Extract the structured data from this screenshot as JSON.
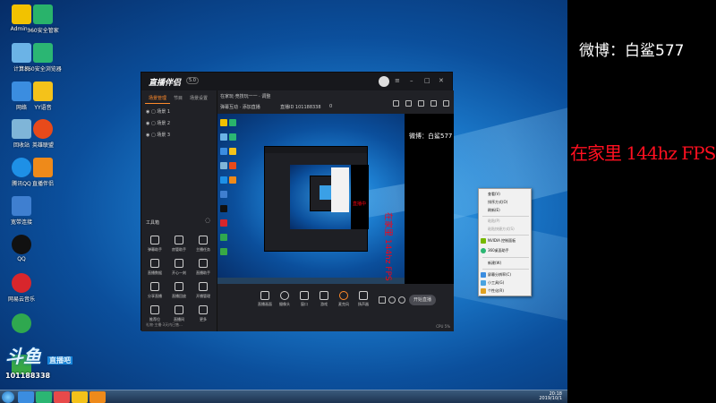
{
  "overlay": {
    "weibo": "微博：白鲨577",
    "highlight": "在家里 144hz  FPS 150"
  },
  "desktop": {
    "icons": [
      {
        "label": "Admin...",
        "color": "#f2c200"
      },
      {
        "label": "360安全管家",
        "color": "#29b36b"
      },
      {
        "label": "计算机",
        "color": "#6bb3e6"
      },
      {
        "label": "360安全浏览器",
        "color": "#2bb673"
      },
      {
        "label": "网络",
        "color": "#3b8de0"
      },
      {
        "label": "YY语音",
        "color": "#f4c21a"
      },
      {
        "label": "回收站",
        "color": "#7fb5d8"
      },
      {
        "label": "英雄联盟",
        "color": "#e84a1a"
      },
      {
        "label": "腾讯QQ",
        "color": "#1e90e6"
      },
      {
        "label": "直播伴侣",
        "color": "#ee8a1a"
      },
      {
        "label": "宽带连接",
        "color": "#3f7fd0"
      },
      {
        "label": "QQ",
        "color": "#111111"
      },
      {
        "label": "网易云音乐",
        "color": "#d8262c"
      },
      {
        "label": "",
        "color": "#2fa84f"
      },
      {
        "label": "",
        "color": "#38a845"
      }
    ],
    "watermark": {
      "logo": "斗鱼",
      "sub": "直播吧",
      "room": "101188338"
    }
  },
  "app": {
    "title": "直播伴侣",
    "version": "5.0",
    "left_tabs": [
      "场景管理",
      "节目",
      "场景设置"
    ],
    "scenes": [
      "场景 1",
      "场景 2",
      "场景 3"
    ],
    "tools_title": "工具箱",
    "tools": [
      "弹幕助手",
      "房管助手",
      "主播任务",
      "直播数据",
      "开心一刻",
      "直播助手",
      "分享直播",
      "直播回放",
      "开播管理",
      "推荐位",
      "直播间",
      "更多"
    ],
    "left_status": "礼物·主播·3天内已售...",
    "header": {
      "room_title": "在家玩·竞技玩一一 · 调整",
      "sub1": "弹幕互动 · 添加直播",
      "sub2": "直播ID 101188338",
      "sub3": "0"
    },
    "bottom_tools": [
      "直播画面",
      "摄像头",
      "窗口",
      "游戏",
      "麦克风",
      "扬声器"
    ],
    "go_live": "开始直播",
    "bottom_status": "CPU 5%"
  },
  "preview": {
    "weibo": "微博：白鲨577",
    "red": "在家里 144hz  FPS 150",
    "inner_red": "直播中"
  },
  "context_menu": {
    "items": [
      {
        "label": "查看(V)",
        "disabled": false
      },
      {
        "label": "排序方式(O)",
        "disabled": false
      },
      {
        "label": "刷新(E)",
        "disabled": false
      },
      {
        "label": "粘贴(P)",
        "disabled": true
      },
      {
        "label": "粘贴快捷方式(S)",
        "disabled": true
      },
      {
        "label": "NVIDIA 控制面板",
        "disabled": false
      },
      {
        "label": "360桌面助手",
        "disabled": false
      },
      {
        "label": "新建(W)",
        "disabled": false
      },
      {
        "label": "屏幕分辨率(C)",
        "disabled": false
      },
      {
        "label": "小工具(G)",
        "disabled": false
      },
      {
        "label": "个性化(R)",
        "disabled": false
      }
    ]
  },
  "taskbar": {
    "clock_time": "20:18",
    "clock_date": "2019/10/1"
  }
}
